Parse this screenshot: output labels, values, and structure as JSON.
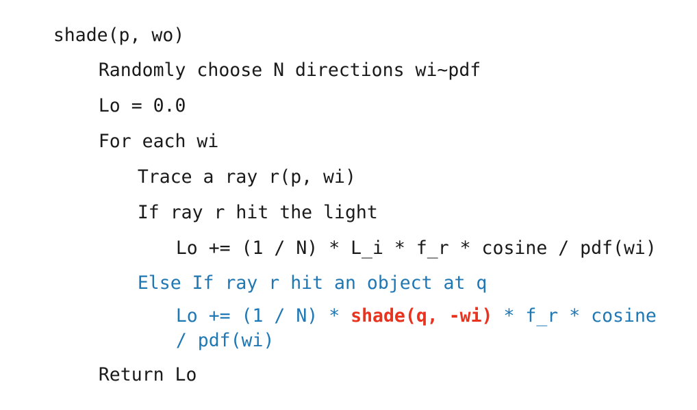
{
  "document": {
    "kind": "pseudocode-listing",
    "title": "shade(p, wo)",
    "background_color": "#ffffff",
    "default_text_color": "#1a1a1a",
    "accent_blue": "#1f77b4",
    "accent_red": "#e8341f"
  },
  "lines": [
    {
      "id": "line-1-function-signature",
      "indent": 0,
      "text": "shade(p, wo)",
      "tokens": [
        {
          "text": "shade(p, wo)",
          "style": "plain"
        }
      ]
    },
    {
      "id": "line-2-sample-directions",
      "indent": 1,
      "text": "Randomly choose N directions wi~pdf",
      "tokens": [
        {
          "text": "Randomly choose N directions wi~pdf",
          "style": "plain"
        }
      ]
    },
    {
      "id": "line-3-init-lo",
      "indent": 1,
      "text": "Lo = 0.0",
      "tokens": [
        {
          "text": "Lo = 0.0",
          "style": "plain"
        }
      ]
    },
    {
      "id": "line-4-for-each-wi",
      "indent": 1,
      "text": "For each wi",
      "tokens": [
        {
          "text": "For each wi",
          "style": "plain"
        }
      ]
    },
    {
      "id": "line-5-trace-ray",
      "indent": 2,
      "text": "Trace a ray r(p, wi)",
      "tokens": [
        {
          "text": "Trace a ray r(p, wi)",
          "style": "plain"
        }
      ]
    },
    {
      "id": "line-6-if-hit-light",
      "indent": 2,
      "text": "If ray r hit the light",
      "tokens": [
        {
          "text": "If ray r hit the light",
          "style": "plain"
        }
      ]
    },
    {
      "id": "line-7-accumulate-direct",
      "indent": 3,
      "text": "Lo += (1 / N) * L_i * f_r * cosine / pdf(wi)",
      "tokens": [
        {
          "text": "Lo += (1 / N) * L_i * f_r * cosine / pdf(wi)",
          "style": "plain"
        }
      ]
    },
    {
      "id": "line-8-else-if-hit-object",
      "indent": 2,
      "text": "Else If ray r hit an object at q",
      "tokens": [
        {
          "text": "Else If ray r hit an object at q",
          "style": "blue"
        }
      ]
    },
    {
      "id": "line-9-accumulate-indirect",
      "indent": 3,
      "text": "Lo += (1 / N) * shade(q, -wi) * f_r * cosine",
      "tokens": [
        {
          "text": "Lo += (1 / N) * ",
          "style": "blue"
        },
        {
          "text": "shade(q, -wi)",
          "style": "red"
        },
        {
          "text": " * f_r * cosine",
          "style": "blue"
        }
      ]
    },
    {
      "id": "line-9b-accumulate-indirect-wrap",
      "indent": 3,
      "text": "/ pdf(wi)",
      "tokens": [
        {
          "text": "/ pdf(wi)",
          "style": "blue"
        }
      ]
    },
    {
      "id": "line-10-return-lo",
      "indent": 1,
      "text": "Return Lo",
      "tokens": [
        {
          "text": "Return Lo",
          "style": "plain"
        }
      ]
    }
  ]
}
